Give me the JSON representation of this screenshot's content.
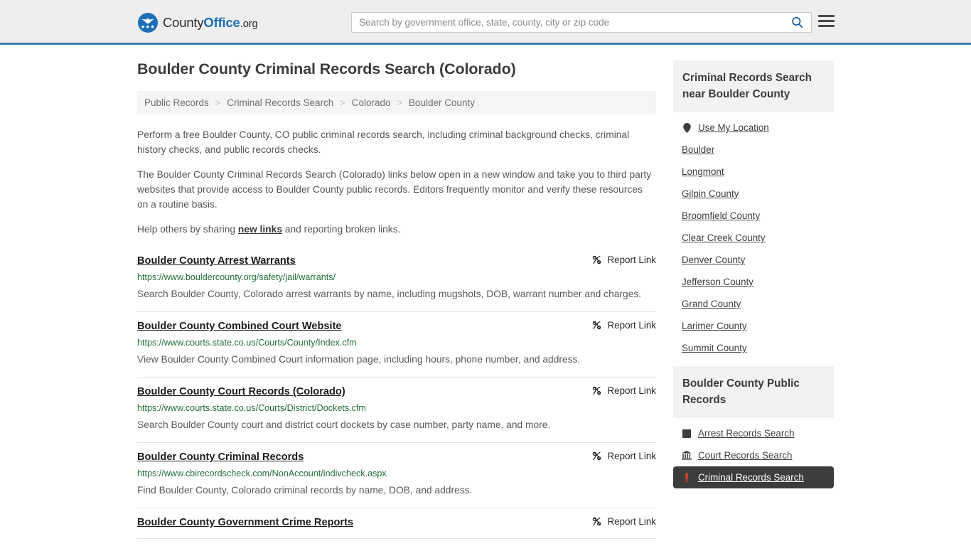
{
  "header": {
    "logo": {
      "part1": "County",
      "part2": "Office",
      "part3": ".org",
      "icon": "eagle-shield-logo",
      "stars": "★★★"
    },
    "search": {
      "placeholder": "Search by government office, state, county, city or zip code",
      "value": "",
      "search_icon": "search-icon"
    },
    "menu_icon": "hamburger-menu-icon",
    "accent_color": "#1c6fb8",
    "border_color": "#3b7ab1",
    "background": "#eeeeee"
  },
  "main": {
    "title": "Boulder County Criminal Records Search (Colorado)",
    "breadcrumb": [
      "Public Records",
      "Criminal Records Search",
      "Colorado",
      "Boulder County"
    ],
    "breadcrumb_separator": ">",
    "intro": {
      "p1": "Perform a free Boulder County, CO public criminal records search, including criminal background checks, criminal history checks, and public records checks.",
      "p2": "The Boulder County Criminal Records Search (Colorado) links below open in a new window and take you to third party websites that provide access to Boulder County public records. Editors frequently monitor and verify these resources on a routine basis.",
      "p3_before": "Help others by sharing ",
      "p3_link": "new links",
      "p3_after": " and reporting broken links."
    },
    "report_link_label": "Report Link",
    "report_link_icon": "broken-link-icon",
    "results": [
      {
        "title": "Boulder County Arrest Warrants",
        "url": "https://www.bouldercounty.org/safety/jail/warrants/",
        "description": "Search Boulder County, Colorado arrest warrants by name, including mugshots, DOB, warrant number and charges."
      },
      {
        "title": "Boulder County Combined Court Website",
        "url": "https://www.courts.state.co.us/Courts/County/Index.cfm",
        "description": "View Boulder County Combined Court information page, including hours, phone number, and address."
      },
      {
        "title": "Boulder County Court Records (Colorado)",
        "url": "https://www.courts.state.co.us/Courts/District/Dockets.cfm",
        "description": "Search Boulder County court and district court dockets by case number, party name, and more."
      },
      {
        "title": "Boulder County Criminal Records",
        "url": "https://www.cbirecordscheck.com/NonAccount/indivcheck.aspx",
        "description": "Find Boulder County, Colorado criminal records by name, DOB, and address."
      },
      {
        "title": "Boulder County Government Crime Reports",
        "url": "",
        "description": ""
      }
    ]
  },
  "sidebar": {
    "nearby": {
      "heading": "Criminal Records Search near Boulder County",
      "items": [
        {
          "label": "Use My Location",
          "icon": "map-pin-icon"
        },
        {
          "label": "Boulder",
          "icon": ""
        },
        {
          "label": "Longmont",
          "icon": ""
        },
        {
          "label": "Gilpin County",
          "icon": ""
        },
        {
          "label": "Broomfield County",
          "icon": ""
        },
        {
          "label": "Clear Creek County",
          "icon": ""
        },
        {
          "label": "Denver County",
          "icon": ""
        },
        {
          "label": "Jefferson County",
          "icon": ""
        },
        {
          "label": "Grand County",
          "icon": ""
        },
        {
          "label": "Larimer County",
          "icon": ""
        },
        {
          "label": "Summit County",
          "icon": ""
        }
      ]
    },
    "public_records": {
      "heading": "Boulder County Public Records",
      "items": [
        {
          "label": "Arrest Records Search",
          "icon": "fingerprint-icon",
          "active": false
        },
        {
          "label": "Court Records Search",
          "icon": "courthouse-icon",
          "active": false
        },
        {
          "label": "Criminal Records Search",
          "icon": "gavel-icon",
          "active": true
        }
      ],
      "active_background": "#3c3c3c"
    }
  }
}
